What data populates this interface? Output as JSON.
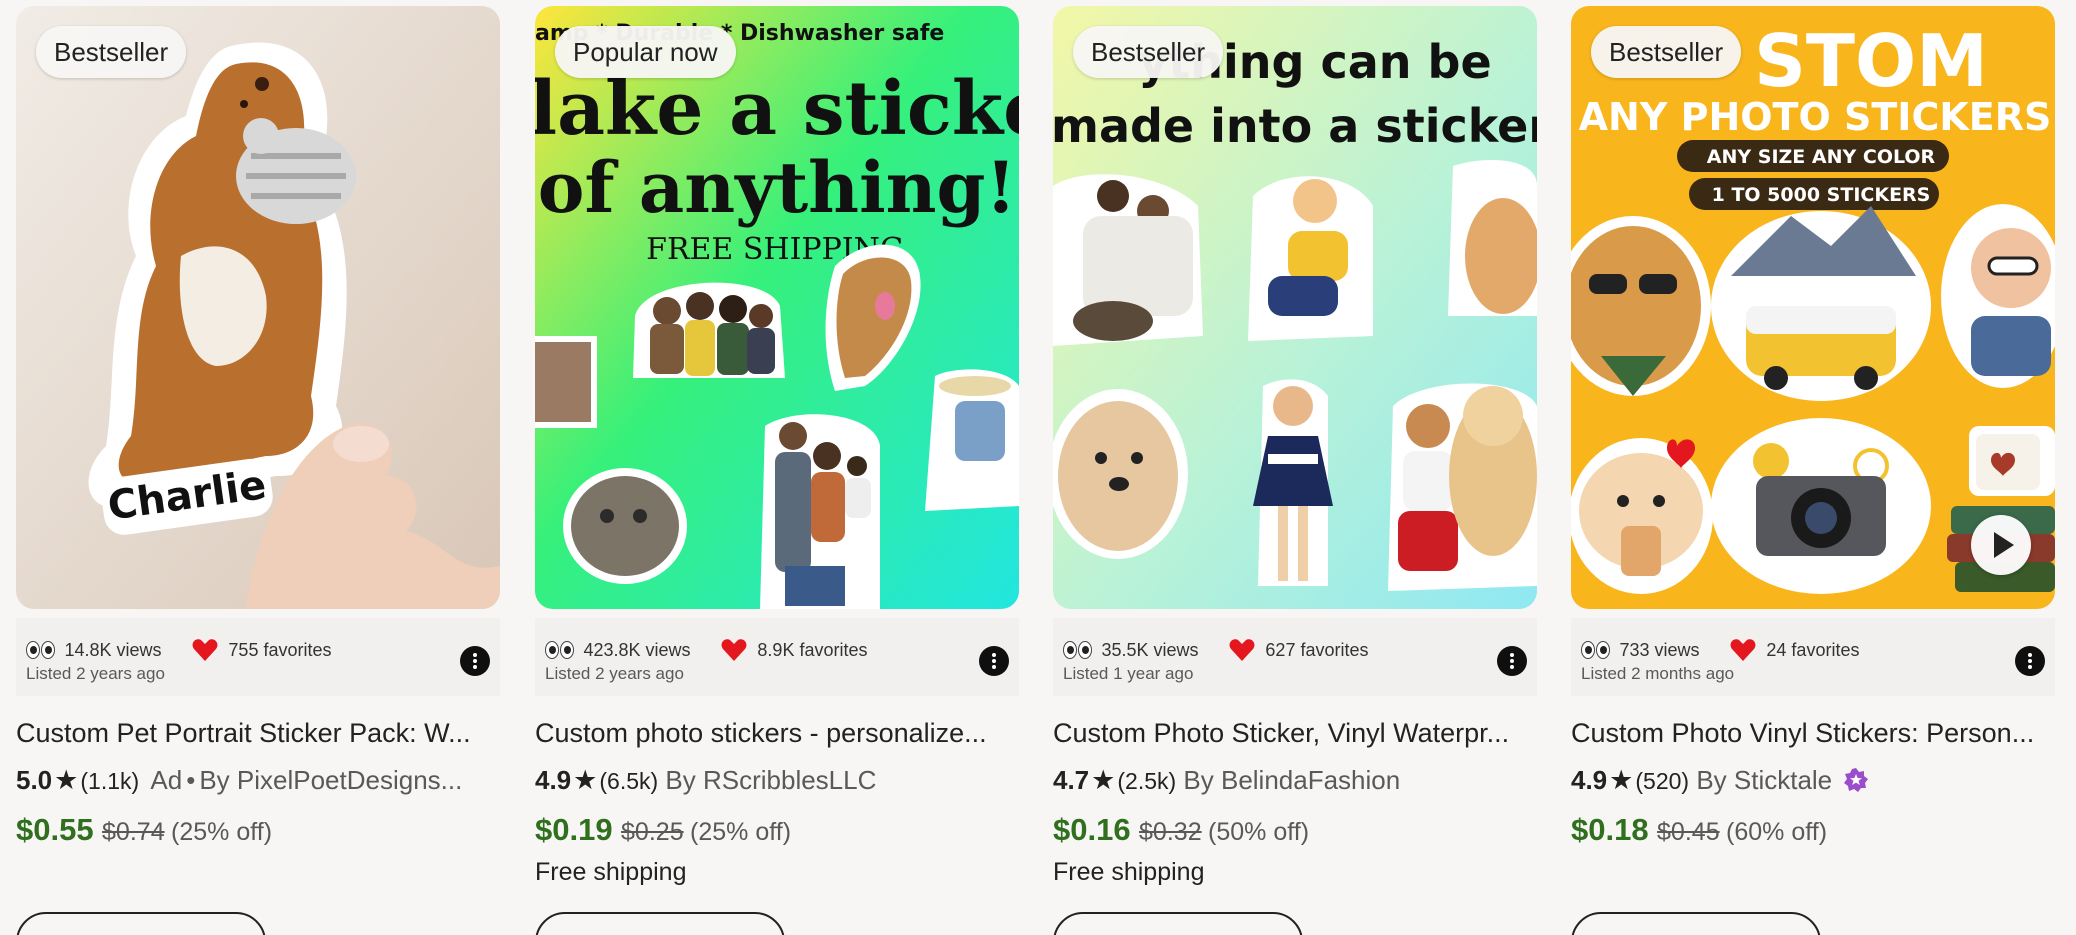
{
  "listings": [
    {
      "badge": "Bestseller",
      "image_text": "Charlie",
      "views": "14.8K views",
      "favorites": "755 favorites",
      "listed": "Listed 2 years ago",
      "title": "Custom Pet Portrait Sticker Pack: W...",
      "rating": "5.0",
      "review_count": "(1.1k)",
      "ad_label": "Ad",
      "shop": "By PixelPoetDesigns...",
      "price": "$0.55",
      "original_price": "$0.74",
      "discount": "(25% off)",
      "shipping": ""
    },
    {
      "badge": "Popular now",
      "image_text": {
        "top": "amp * Durable * Dishwasher safe",
        "line1": "lake a sticker ou",
        "line2": "of anything!",
        "line3": "FREE SHIPPING"
      },
      "views": "423.8K views",
      "favorites": "8.9K favorites",
      "listed": "Listed 2 years ago",
      "title": "Custom photo stickers - personalize...",
      "rating": "4.9",
      "review_count": "(6.5k)",
      "shop": "By RScribblesLLC",
      "price": "$0.19",
      "original_price": "$0.25",
      "discount": "(25% off)",
      "shipping": "Free shipping"
    },
    {
      "badge": "Bestseller",
      "image_text": {
        "line1": "ything can be",
        "line2": "made into a sticker"
      },
      "views": "35.5K views",
      "favorites": "627 favorites",
      "listed": "Listed 1 year ago",
      "title": "Custom Photo Sticker, Vinyl Waterpr...",
      "rating": "4.7",
      "review_count": "(2.5k)",
      "shop": "By BelindaFashion",
      "price": "$0.16",
      "original_price": "$0.32",
      "discount": "(50% off)",
      "shipping": "Free shipping"
    },
    {
      "badge": "Bestseller",
      "image_text": {
        "line1": "STOM",
        "line2": "ANY PHOTO STICKERS",
        "pill1": "ANY SIZE ANY COLOR",
        "pill2": "1 TO 5000 STICKERS"
      },
      "views": "733 views",
      "favorites": "24 favorites",
      "listed": "Listed 2 months ago",
      "title": "Custom Photo Vinyl Stickers: Person...",
      "rating": "4.9",
      "review_count": "(520)",
      "shop": "By Sticktale",
      "price": "$0.18",
      "original_price": "$0.45",
      "discount": "(60% off)",
      "shipping": ""
    }
  ],
  "star_glyph": "★",
  "separator": "•",
  "colors": {
    "price_green": "#2f6f1e",
    "heart_red": "#e3171d",
    "star_seller_purple": "#9b4dca",
    "badge_bg": "#f7f6f4"
  },
  "icons": [
    "eyes-icon",
    "heart-icon",
    "star-icon",
    "more-options-icon",
    "play-icon",
    "star-seller-icon"
  ]
}
